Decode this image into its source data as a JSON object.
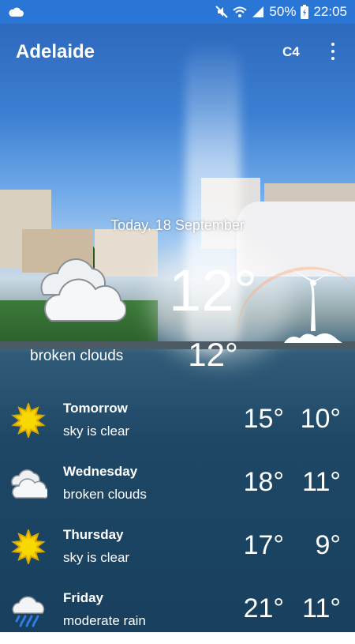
{
  "status_bar": {
    "battery": "50%",
    "time": "22:05",
    "icons": [
      "cloud-icon",
      "mute-icon",
      "wifi-icon",
      "signal-icon",
      "battery-icon"
    ]
  },
  "app_bar": {
    "city": "Adelaide",
    "unit_toggle": "C4",
    "menu_icon": "more-vertical-icon"
  },
  "current": {
    "date": "Today, 18 September",
    "temperature": "12°",
    "feels_like": "12°",
    "description": "broken clouds",
    "icon": "broken-clouds-icon",
    "wind_icon": "wind-turbine-icon"
  },
  "forecast": [
    {
      "day": "Tomorrow",
      "condition": "sky is clear",
      "high": "15°",
      "low": "10°",
      "icon": "sun-icon"
    },
    {
      "day": "Wednesday",
      "condition": "broken clouds",
      "high": "18°",
      "low": "11°",
      "icon": "clouds-icon"
    },
    {
      "day": "Thursday",
      "condition": "sky is clear",
      "high": "17°",
      "low": "9°",
      "icon": "sun-icon"
    },
    {
      "day": "Friday",
      "condition": "moderate rain",
      "high": "21°",
      "low": "11°",
      "icon": "rain-icon"
    }
  ],
  "colors": {
    "status_bar": "#2a76d6",
    "sun": "#f5d100",
    "rain": "#2f7de1"
  }
}
